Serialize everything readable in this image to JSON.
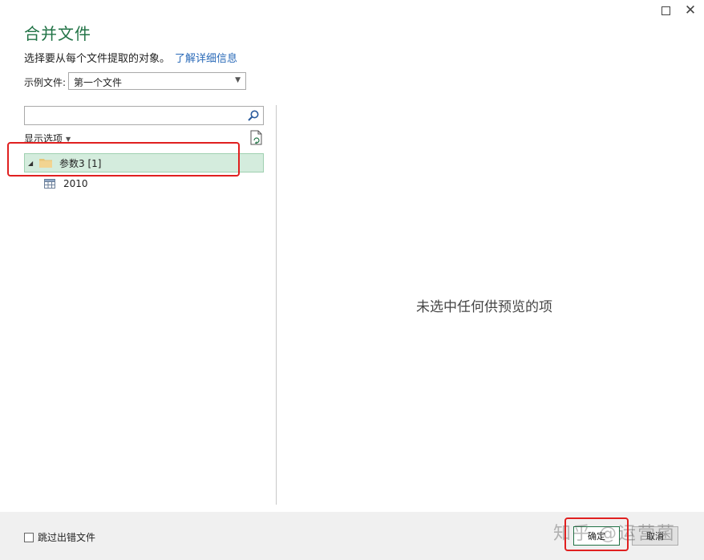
{
  "window": {
    "maximize_glyph": "□",
    "close_glyph": "✕"
  },
  "title": "合并文件",
  "subtitle": {
    "text": "选择要从每个文件提取的对象。",
    "link": "了解详细信息"
  },
  "example": {
    "label": "示例文件:",
    "value": "第一个文件"
  },
  "search": {
    "placeholder": ""
  },
  "options_label": "显示选项",
  "tree": [
    {
      "label": "参数3 [1]",
      "icon": "folder-icon",
      "selected": true
    },
    {
      "label": "2010",
      "icon": "table-icon",
      "selected": false
    }
  ],
  "preview_message": "未选中任何供预览的项",
  "footer": {
    "skip_label": "跳过出错文件",
    "ok_label": "确定",
    "cancel_label": "取消",
    "watermark": "知乎 @运营菌"
  },
  "colors": {
    "accent": "#217346",
    "selection": "#d4ecdd",
    "highlight": "#e02020",
    "link": "#2a6ab8"
  }
}
